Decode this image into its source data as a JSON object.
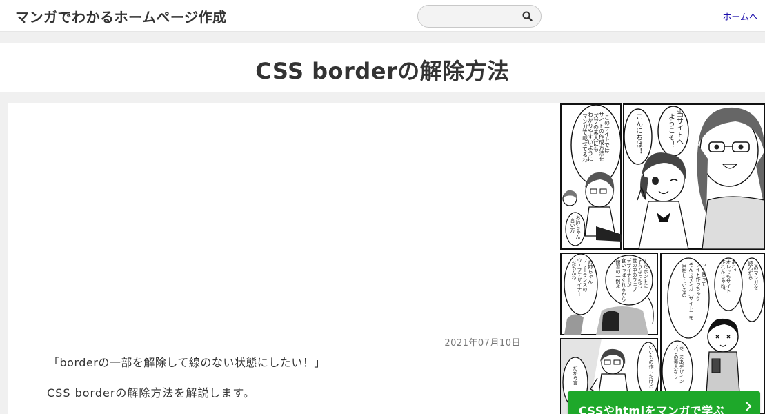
{
  "header": {
    "site_title": "マンガでわかるホームページ作成",
    "search": {
      "placeholder": "",
      "icon": "search-icon"
    },
    "home_link": "ホームへ"
  },
  "page": {
    "title": "CSS borderの解除方法"
  },
  "article": {
    "date": "2021年07月10日",
    "paragraphs": [
      "「borderの一部を解除して線のない状態にしたい！」",
      "CSS borderの解除方法を解説します。"
    ]
  },
  "manga": {
    "balloons": [
      "このサイトでは",
      "サイトの作成方法を",
      "ズブの素人にも",
      "わかりやすいように",
      "マンガで載せてるわ",
      "こんにちは！",
      "当サイトへ",
      "ようこそ！",
      "お姉ちゃん",
      "言い方",
      "お姉ちゃん",
      "フリーランスの",
      "ウェブデザイナー",
      "だもんね",
      "ただホントに",
      "そうなったら",
      "世の中のウェブ",
      "デザイナーが",
      "食いっぱぐれるから",
      "練習の一例よ",
      "って思って",
      "サイト作っちゃう",
      "そんでマンガ（サイト）を",
      "目指しているの",
      "あれ？",
      "オレでもサイト",
      "作れんじゃね？",
      "このマンガを",
      "読んだら",
      "ま、まあデザイン",
      "ズブの素人なり",
      "いいもの作ったけど",
      "だから言"
    ],
    "accent_color": "#1ea82a"
  },
  "cta": {
    "label": "CSSやhtmlをマンガで学ぶ",
    "arrow_icon": "chevron-right-icon"
  }
}
